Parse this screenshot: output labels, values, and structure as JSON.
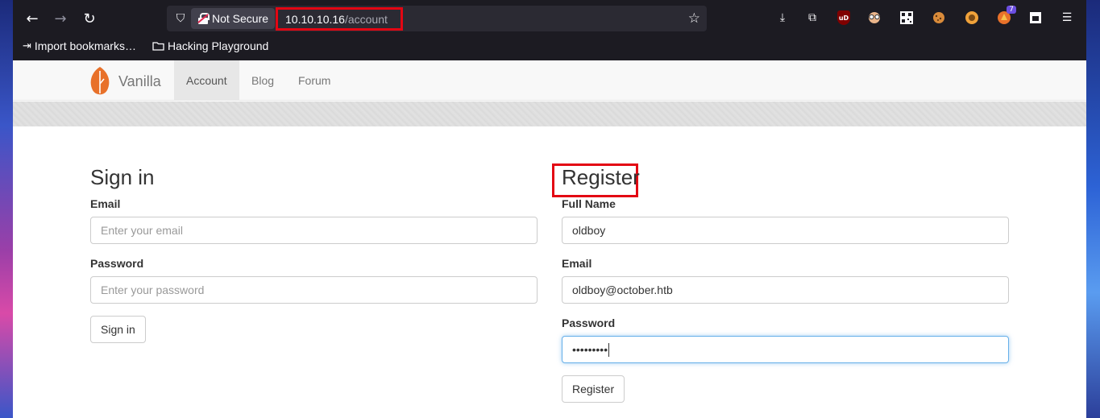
{
  "browser": {
    "security_label": "Not Secure",
    "url_host": "10.10.10.16",
    "url_path": "/account",
    "extension_badge": "7",
    "bookmarks": [
      {
        "label": "Import bookmarks…"
      },
      {
        "label": "Hacking Playground"
      }
    ]
  },
  "site": {
    "brand": "Vanilla",
    "nav": [
      {
        "label": "Account",
        "active": true
      },
      {
        "label": "Blog",
        "active": false
      },
      {
        "label": "Forum",
        "active": false
      }
    ]
  },
  "signin": {
    "title": "Sign in",
    "email_label": "Email",
    "email_placeholder": "Enter your email",
    "password_label": "Password",
    "password_placeholder": "Enter your password",
    "button": "Sign in"
  },
  "register": {
    "title": "Register",
    "fullname_label": "Full Name",
    "fullname_value": "oldboy",
    "email_label": "Email",
    "email_value": "oldboy@october.htb",
    "password_label": "Password",
    "password_value": "•••••••••",
    "button": "Register"
  },
  "colors": {
    "highlight": "#e30613",
    "brand_orange": "#e8712a"
  }
}
